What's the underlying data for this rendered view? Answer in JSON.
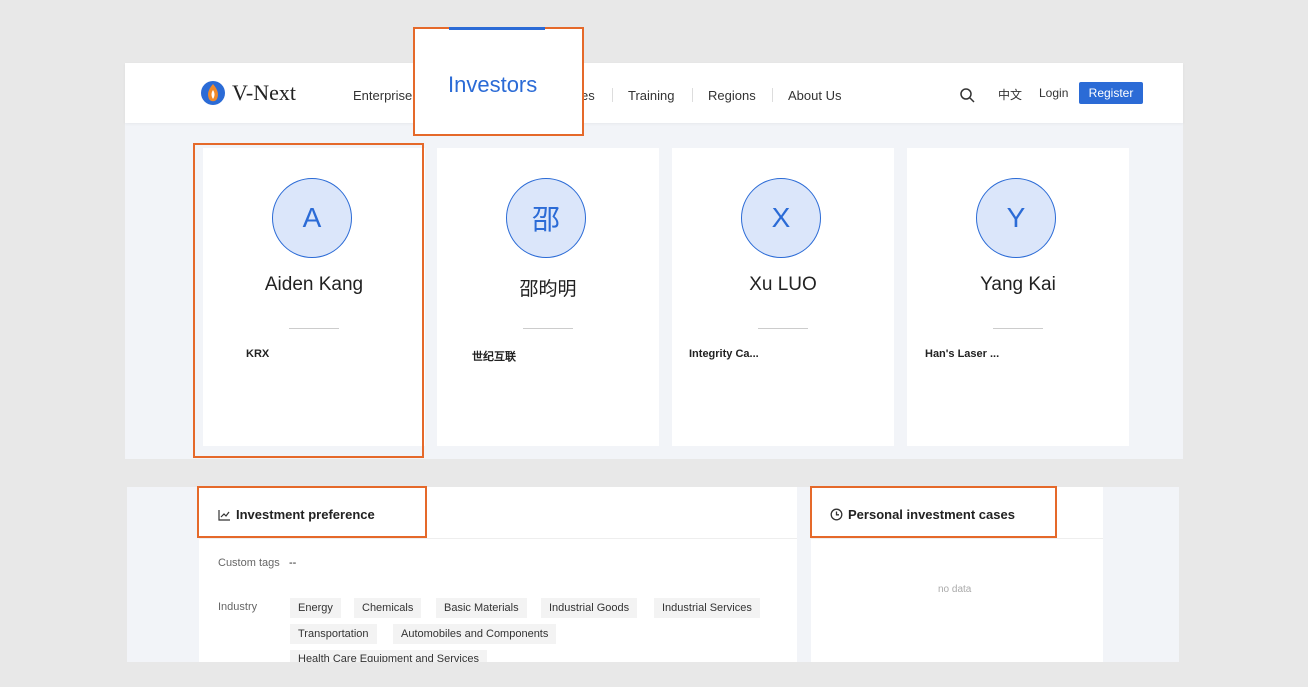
{
  "brand": {
    "name": "V-Next"
  },
  "nav": {
    "items": [
      "Enterprise",
      "Investors",
      "es",
      "Training",
      "Regions",
      "About Us"
    ],
    "active": "Investors",
    "search_icon": "search-icon",
    "lang": "中文",
    "login": "Login",
    "register": "Register"
  },
  "investors": [
    {
      "initial": "A",
      "name": "Aiden Kang",
      "org": "KRX"
    },
    {
      "initial": "邵",
      "name": "邵昀明",
      "org": "世纪互联"
    },
    {
      "initial": "X",
      "name": "Xu LUO",
      "org": "Integrity Ca..."
    },
    {
      "initial": "Y",
      "name": "Yang Kai",
      "org": "Han's Laser ..."
    }
  ],
  "preference": {
    "title": "Investment preference",
    "custom_tags_label": "Custom tags",
    "custom_tags_value": "--",
    "industry_label": "Industry",
    "industry_tags": [
      "Energy",
      "Chemicals",
      "Basic Materials",
      "Industrial Goods",
      "Industrial Services",
      "Transportation",
      "Automobiles and Components",
      "Health Care Equipment and Services"
    ]
  },
  "cases": {
    "title": "Personal investment cases",
    "empty": "no data"
  },
  "colors": {
    "accent": "#2b6bd6",
    "highlight": "#e5692a"
  }
}
